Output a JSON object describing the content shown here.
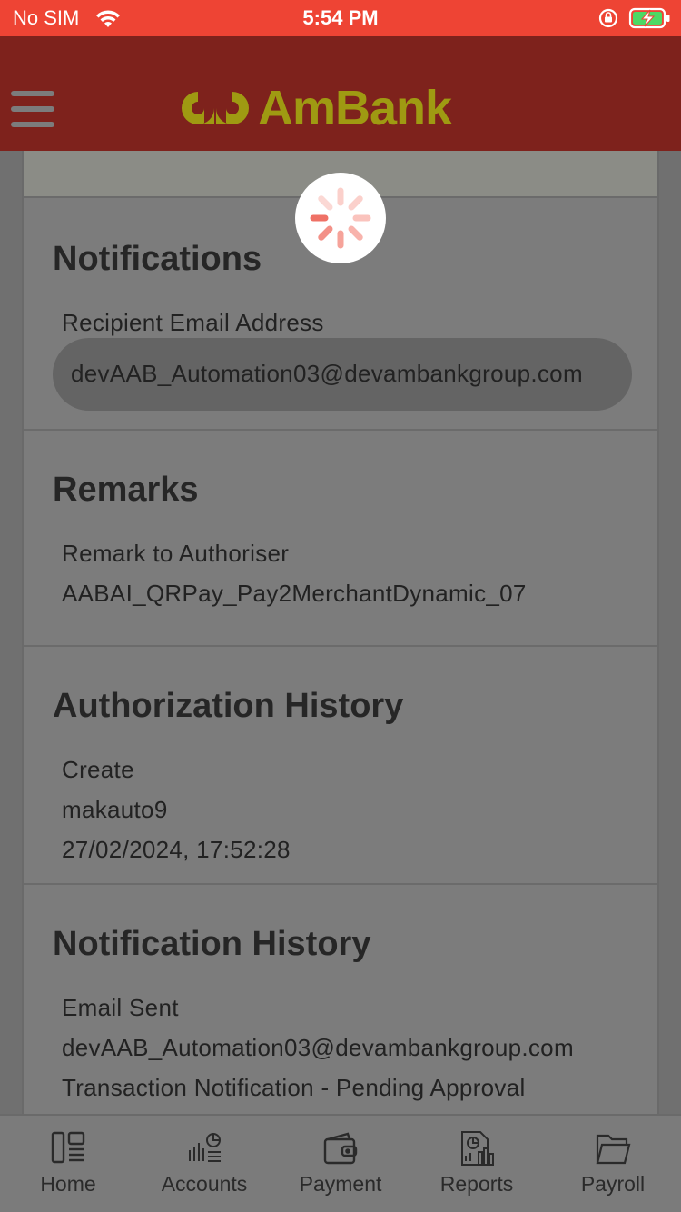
{
  "status_bar": {
    "carrier": "No SIM",
    "time": "5:54 PM",
    "icons": [
      "wifi-icon",
      "rotation-lock-icon",
      "battery-charging-icon"
    ]
  },
  "header": {
    "logo_text": "AmBank",
    "brand_color": "#9f9a12",
    "header_color": "#7e221c",
    "status_color": "#ee4434"
  },
  "notifications": {
    "title": "Notifications",
    "email_label": "Recipient Email Address",
    "email_value": "devAAB_Automation03@devambankgroup.com"
  },
  "remarks": {
    "title": "Remarks",
    "label": "Remark to Authoriser",
    "value": "AABAI_QRPay_Pay2MerchantDynamic_07"
  },
  "authorization_history": {
    "title": "Authorization History",
    "action": "Create",
    "user": "makauto9",
    "timestamp": "27/02/2024, 17:52:28"
  },
  "notification_history": {
    "title": "Notification History",
    "event": "Email Sent",
    "recipient": "devAAB_Automation03@devambankgroup.com",
    "subject": "Transaction Notification - Pending Approval"
  },
  "bottom_nav": {
    "items": [
      {
        "label": "Home",
        "icon": "home-icon"
      },
      {
        "label": "Accounts",
        "icon": "accounts-icon"
      },
      {
        "label": "Payment",
        "icon": "wallet-icon"
      },
      {
        "label": "Reports",
        "icon": "reports-icon"
      },
      {
        "label": "Payroll",
        "icon": "folder-icon"
      }
    ]
  }
}
